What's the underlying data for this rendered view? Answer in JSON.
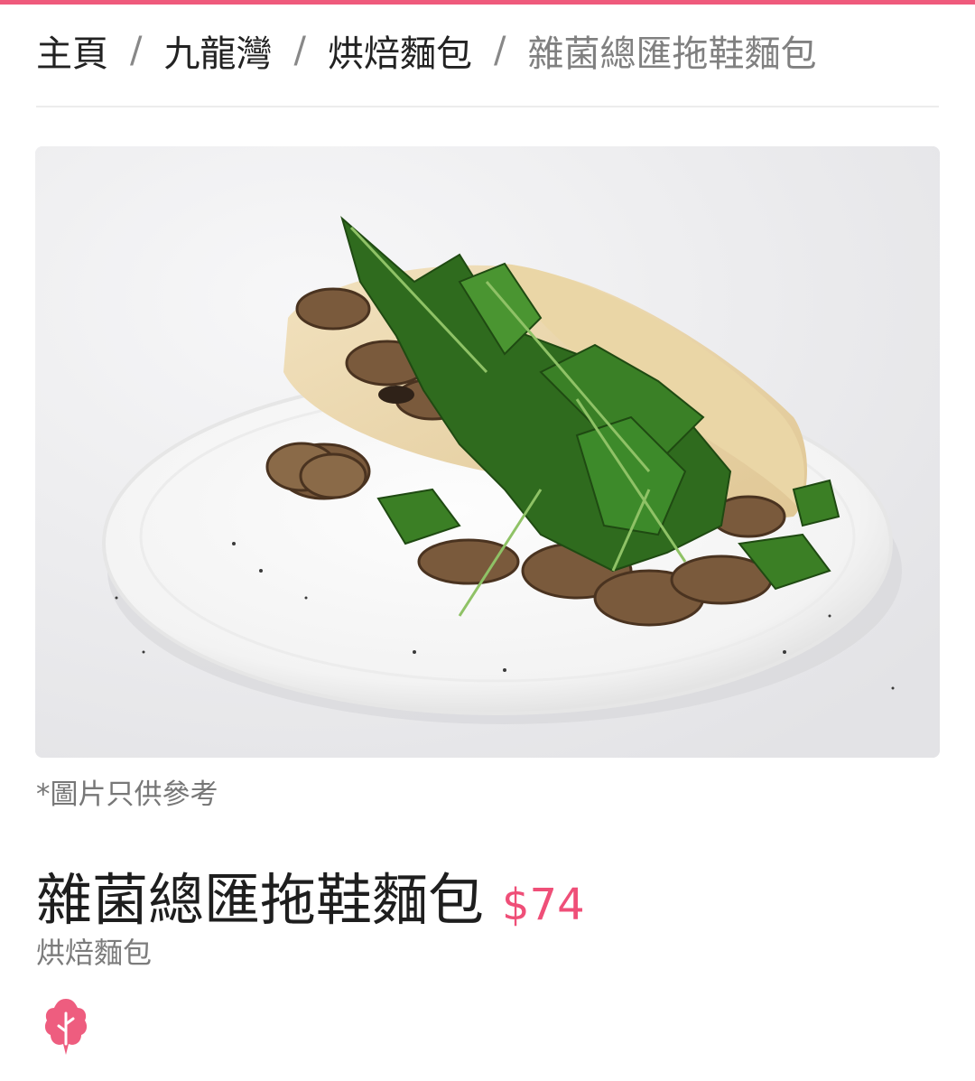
{
  "breadcrumb": {
    "items": [
      {
        "label": "主頁"
      },
      {
        "label": "九龍灣"
      },
      {
        "label": "烘焙麵包"
      },
      {
        "label": "雜菌總匯拖鞋麵包"
      }
    ],
    "separator": "/"
  },
  "image": {
    "description_icon": "sandwich-photo",
    "disclaimer": "*圖片只供參考"
  },
  "product": {
    "name": "雜菌總匯拖鞋麵包",
    "price": "$74",
    "category": "烘焙麵包",
    "badge_icon": "vegetarian-leaf-icon"
  },
  "colors": {
    "accent": "#ef5a7c",
    "price": "#ef4f78"
  }
}
